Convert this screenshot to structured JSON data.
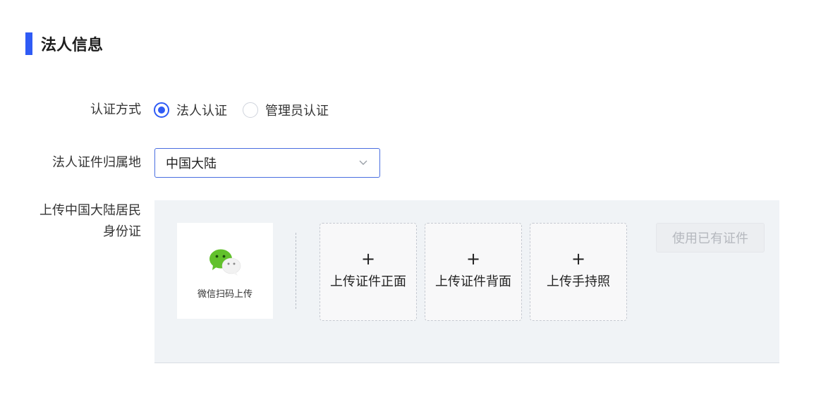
{
  "section": {
    "title": "法人信息"
  },
  "form": {
    "auth_method": {
      "label": "认证方式",
      "options": [
        {
          "label": "法人认证",
          "checked": true
        },
        {
          "label": "管理员认证",
          "checked": false
        }
      ]
    },
    "id_region": {
      "label": "法人证件归属地",
      "value": "中国大陆"
    },
    "upload": {
      "label_line1": "上传中国大陆居民",
      "label_line2": "身份证",
      "wechat_label": "微信扫码上传",
      "front_label": "上传证件正面",
      "back_label": "上传证件背面",
      "handheld_label": "上传手持照",
      "plus": "+",
      "existing_button": "使用已有证件"
    }
  },
  "colors": {
    "accent": "#2f5bf5",
    "wechat_green": "#62c12c",
    "upload_bg": "#f0f3f6"
  }
}
